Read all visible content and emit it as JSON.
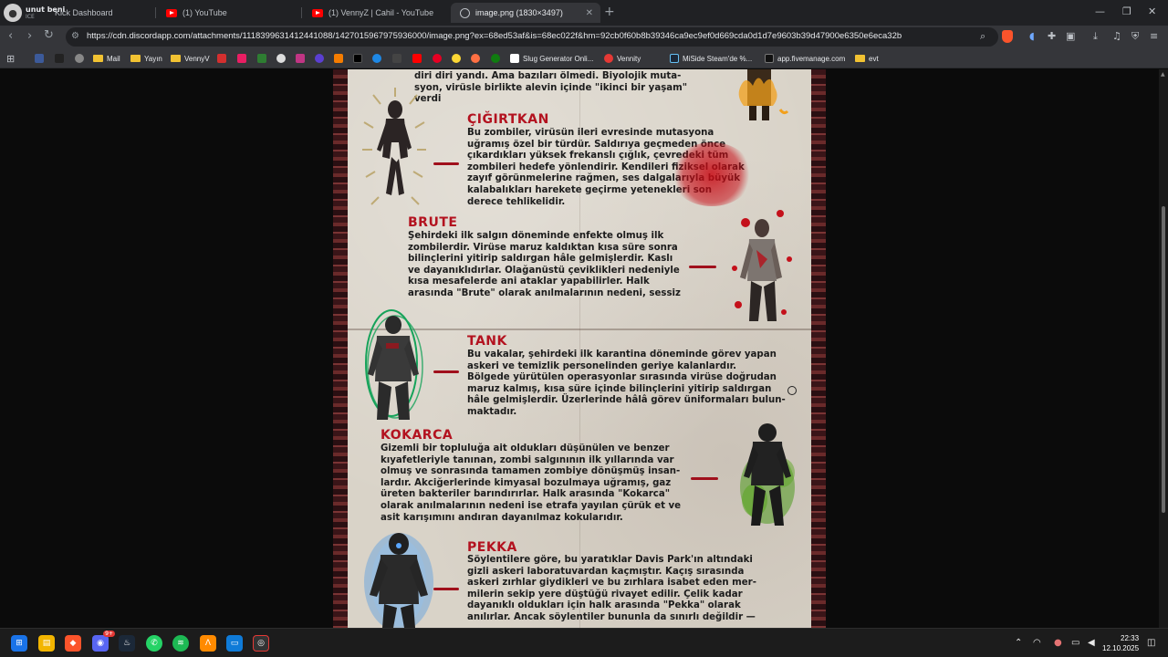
{
  "browser": {
    "profile": {
      "name": "unut beni",
      "sub": "ICE"
    },
    "tabs": [
      {
        "label": "Kick Dashboard",
        "icon": "kick-icon"
      },
      {
        "label": "(1) YouTube",
        "icon": "youtube-icon"
      },
      {
        "label": "(1) VennyZ | Cahil - YouTube",
        "icon": "youtube-icon"
      },
      {
        "label": "image.png (1830×3497)",
        "icon": "globe-icon",
        "active": true
      }
    ],
    "url": "https://cdn.discordapp.com/attachments/1118399631412441088/1427015967975936000/image.png?ex=68ed53af&is=68ec022f&hm=92cb0f60b8b39346ca9ec9ef0d669cda0d1d7e9603b39d47900e6350e6eca32b",
    "bookmarks": [
      {
        "label": "Mail",
        "type": "folder"
      },
      {
        "label": "Yayın",
        "type": "folder"
      },
      {
        "label": "VennyV",
        "type": "folder"
      },
      {
        "label": "Slug Generator Onli...",
        "type": "site"
      },
      {
        "label": "Vennity",
        "type": "site"
      },
      {
        "label": "MiSide Steam'de %...",
        "type": "site"
      },
      {
        "label": "app.fivemanage.com",
        "type": "site"
      },
      {
        "label": "evt",
        "type": "folder"
      }
    ]
  },
  "document": {
    "intro": "diri diri yandı. Ama bazıları ölmedi. Biyolojik muta-\nsyon, virüsle birlikte alevin içinde \"ikinci bir yaşam\"\nverdi",
    "sections": [
      {
        "title": "ÇIĞIRTKAN",
        "text": "Bu zombiler, virüsün ileri evresinde mutasyona\nuğramış özel bir türdür. Saldırıya geçmeden önce\nçıkardıkları yüksek frekanslı çığlık, çevredeki tüm\nzombileri hedefe yönlendirir. Kendileri fiziksel olarak\nzayıf görünmelerine rağmen, ses dalgalarıyla büyük\nkalabalıkları harekete geçirme yetenekleri son\nderece tehlikelidir."
      },
      {
        "title": "BRUTE",
        "text": "Şehirdeki ilk salgın döneminde enfekte olmuş ilk\nzombilerdir. Virüse maruz kaldıktan kısa süre sonra\nbilinçlerini yitirip saldırgan hâle gelmişlerdir. Kaslı\nve dayanıklıdırlar. Olağanüstü çeviklikleri nedeniyle\nkısa mesafelerde ani ataklar yapabilirler. Halk\narasında \"Brute\" olarak anılmalarının nedeni, sessiz"
      },
      {
        "title": "TANK",
        "text": "Bu vakalar, şehirdeki ilk karantina döneminde görev yapan\naskeri ve temizlik personelinden geriye kalanlardır.\nBölgede yürütülen operasyonlar sırasında virüse doğrudan\nmaruz kalmış, kısa süre içinde bilinçlerini yitirip saldırgan\nhâle gelmişlerdir. Üzerlerinde hâlâ görev üniformaları bulun-\nmaktadır."
      },
      {
        "title": "KOKARCA",
        "text": "Gizemli bir topluluğa ait oldukları düşünülen ve benzer\nkıyafetleriyle tanınan, zombi salgınının ilk yıllarında var\nolmuş ve sonrasında tamamen zombiye dönüşmüş insan-\nlardır. Akciğerlerinde kimyasal bozulmaya uğramış, gaz\nüreten bakteriler barındırırlar. Halk arasında \"Kokarca\"\nolarak anılmalarının nedeni ise etrafa yayılan çürük et ve\nasit karışımını andıran dayanılmaz kokularıdır."
      },
      {
        "title": "PEKKA",
        "text": "Söylentilere göre, bu yaratıklar Davis Park'ın altındaki\ngizli askeri laboratuvardan kaçmıştır. Kaçış sırasında\naskeri zırhlar giydikleri ve bu zırhlara isabet eden mer-\nmilerin sekip yere düştüğü rivayet edilir. Çelik kadar\ndayanıklı oldukları için halk arasında \"Pekka\" olarak\nanılırlar. Ancak söylentiler bununla da sınırlı değildir —"
      }
    ]
  },
  "taskbar": {
    "time": "22:33",
    "date": "12.10.2025",
    "badge": "9+"
  },
  "colors": {
    "accent_red": "#b3121f",
    "paper": "#d9d3c8",
    "tab_bg": "#202124",
    "toolbar_bg": "#35363a"
  }
}
